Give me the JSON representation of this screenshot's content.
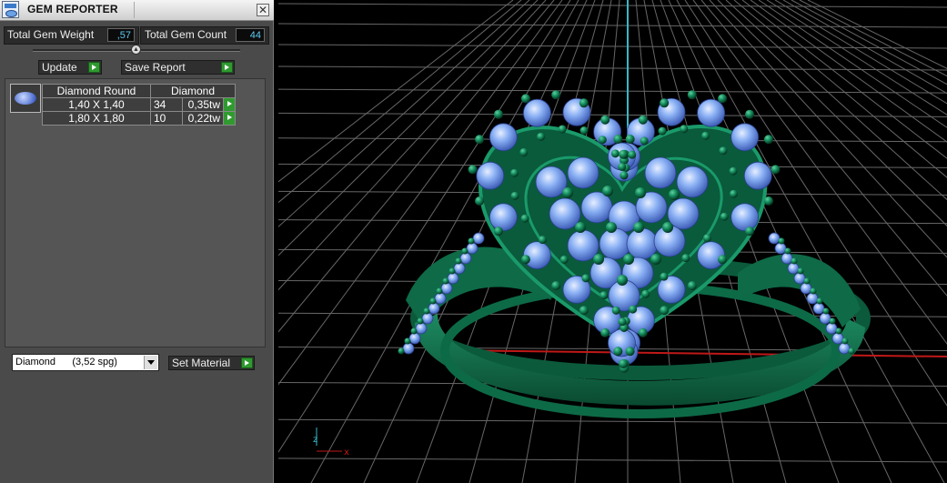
{
  "window": {
    "title": "GEM REPORTER",
    "close_glyph": "✕"
  },
  "stats": {
    "total_weight_label": "Total Gem Weight",
    "total_weight_value": ",57",
    "total_count_label": "Total Gem Count",
    "total_count_value": "44"
  },
  "buttons": {
    "update": "Update",
    "save_report": "Save Report",
    "set_material": "Set Material"
  },
  "gem_table": {
    "shape": "Diamond Round",
    "material": "Diamond",
    "rows": [
      {
        "size": "1,40 X 1,40",
        "count": "34",
        "weight": "0,35tw"
      },
      {
        "size": "1,80 X 1,80",
        "count": "10",
        "weight": "0,22tw"
      }
    ]
  },
  "material_select": {
    "value": "Diamond      (3,52 spg)"
  },
  "viewport": {
    "axis_labels": {
      "z": "z",
      "x": "x"
    },
    "colors": {
      "metal": "#0f6a48",
      "gem": "#7aa6f0",
      "grid": "#7a7a7a",
      "axis_y": "#38b8c8",
      "axis_x": "#c01818"
    }
  }
}
